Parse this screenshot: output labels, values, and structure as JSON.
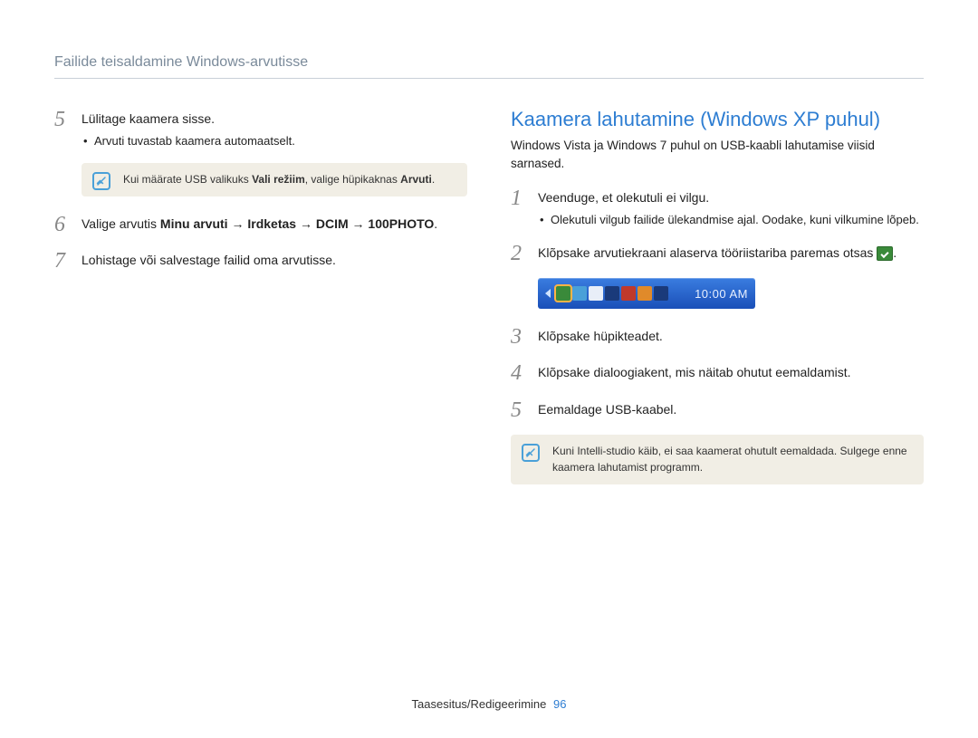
{
  "header": {
    "title": "Failide teisaldamine Windows-arvutisse"
  },
  "left": {
    "steps": [
      {
        "num": "5",
        "text": "Lülitage kaamera sisse.",
        "sub": "Arvuti tuvastab kaamera automaatselt."
      },
      {
        "num": "6",
        "prefix": "Valige arvutis ",
        "b1": "Minu arvuti",
        "arrow": " → ",
        "b2": "Irdketas",
        "b3": "DCIM",
        "b4": "100PHOTO",
        "suffix": "."
      },
      {
        "num": "7",
        "text": "Lohistage või salvestage failid oma arvutisse."
      }
    ],
    "note": {
      "pre": "Kui määrate USB valikuks ",
      "b1": "Vali režiim",
      "mid": ", valige hüpikaknas ",
      "b2": "Arvuti",
      "post": "."
    }
  },
  "right": {
    "title": "Kaamera lahutamine (Windows XP puhul)",
    "intro": "Windows Vista ja Windows 7 puhul on USB-kaabli lahutamise viisid sarnased.",
    "steps": [
      {
        "num": "1",
        "text": "Veenduge, et olekutuli ei vilgu.",
        "sub": "Olekutuli vilgub failide ülekandmise ajal. Oodake, kuni vilkumine lõpeb."
      },
      {
        "num": "2",
        "text_a": "Klõpsake arvutiekraani alaserva tööriistariba paremas otsas ",
        "text_b": "."
      },
      {
        "num": "3",
        "text": "Klõpsake hüpikteadet."
      },
      {
        "num": "4",
        "text": "Klõpsake dialoogiakent, mis näitab ohutut eemaldamist."
      },
      {
        "num": "5",
        "text": "Eemaldage USB-kaabel."
      }
    ],
    "taskbar": {
      "clock": "10:00 AM"
    },
    "note": "Kuni Intelli-studio käib, ei saa kaamerat ohutult eemaldada. Sulgege enne kaamera lahutamist programm."
  },
  "footer": {
    "section": "Taasesitus/Redigeerimine",
    "page": "96"
  }
}
